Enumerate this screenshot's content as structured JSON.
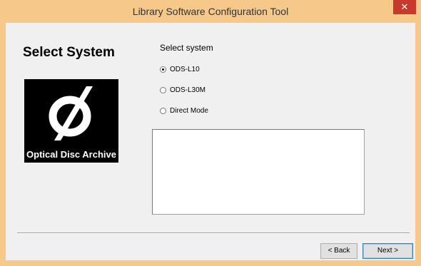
{
  "window": {
    "title": "Library Software Configuration Tool",
    "close_glyph": "✕"
  },
  "page": {
    "heading": "Select System"
  },
  "logo": {
    "caption": "Optical Disc Archive",
    "symbol": "slashed-circle-logo"
  },
  "system_group": {
    "label": "Select system",
    "options": [
      {
        "label": "ODS-L10",
        "selected": true
      },
      {
        "label": "ODS-L30M",
        "selected": false
      },
      {
        "label": "Direct Mode",
        "selected": false
      }
    ]
  },
  "description_box": {
    "value": ""
  },
  "buttons": {
    "back_label": "< Back",
    "next_label": "Next >"
  },
  "colors": {
    "title_bar": "#f6c98a",
    "close_button": "#c7392b"
  }
}
